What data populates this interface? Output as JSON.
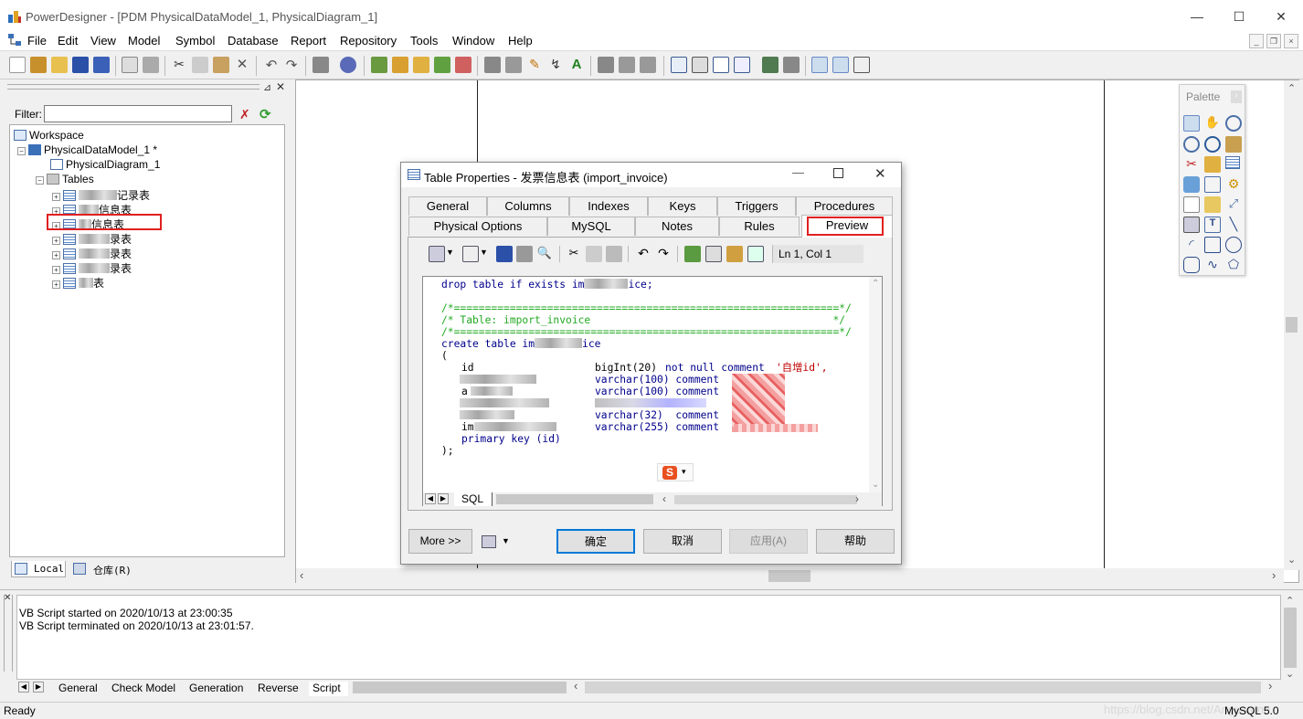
{
  "app": {
    "title": "PowerDesigner - [PDM PhysicalDataModel_1, PhysicalDiagram_1]"
  },
  "window_controls": {
    "minimize": "—",
    "maximize": "☐",
    "close": "✕"
  },
  "menu": [
    "File",
    "Edit",
    "View",
    "Model",
    "Symbol",
    "Database",
    "Report",
    "Repository",
    "Tools",
    "Window",
    "Help"
  ],
  "browser": {
    "filter_label": "Filter:",
    "filter_value": "",
    "tree": {
      "workspace": "Workspace",
      "model": "PhysicalDataModel_1 *",
      "diagram": "PhysicalDiagram_1",
      "tables_folder": "Tables",
      "tables": [
        "记录表",
        "信息表",
        "信息表",
        "录表",
        "录表",
        "录表",
        "表"
      ]
    },
    "tabs": [
      "Local",
      "仓库(R)"
    ]
  },
  "palette": {
    "title": "Palette"
  },
  "dialog": {
    "title": "Table Properties - 发票信息表 (import_invoice)",
    "tabs_row1": [
      "General",
      "Columns",
      "Indexes",
      "Keys",
      "Triggers",
      "Procedures"
    ],
    "tabs_row2": [
      "Physical Options",
      "MySQL",
      "Notes",
      "Rules",
      "Preview"
    ],
    "active_tab": "Preview",
    "cursor_pos": "Ln 1, Col 1",
    "sql": {
      "line1_a": "drop table if exists im",
      "line1_b": "ice;",
      "sep": "/*==============================================================*/",
      "table_comment": "/* Table: import_invoice                                       */",
      "create_a": "create table im",
      "create_b": "ice",
      "open": "(",
      "col1_name": "id",
      "col1_type": "bigInt(20)",
      "col1_mod": "not null comment",
      "col1_cmt": "'自增id',",
      "col2_type": "varchar(100) comment",
      "col3_name": "a",
      "col3_type": "varchar(100) comment",
      "col5_type": "varchar(32)  comment",
      "col6_name": "im",
      "col6_type": "varchar(255) comment",
      "pk": "primary key (id)",
      "close": ");"
    },
    "editor_tab": "SQL",
    "more_button": "More >>",
    "buttons": {
      "ok": "确定",
      "cancel": "取消",
      "apply": "应用(A)",
      "help": "帮助"
    }
  },
  "output": {
    "lines": [
      "VB Script started on 2020/10/13 at 23:00:35",
      "VB Script terminated on 2020/10/13 at 23:01:57."
    ],
    "tabs": [
      "General",
      "Check Model",
      "Generation",
      "Reverse",
      "Script"
    ]
  },
  "status": {
    "left": "Ready",
    "right": "MySQL 5.0",
    "watermark": "https://blog.csdn.net/Angustone"
  }
}
